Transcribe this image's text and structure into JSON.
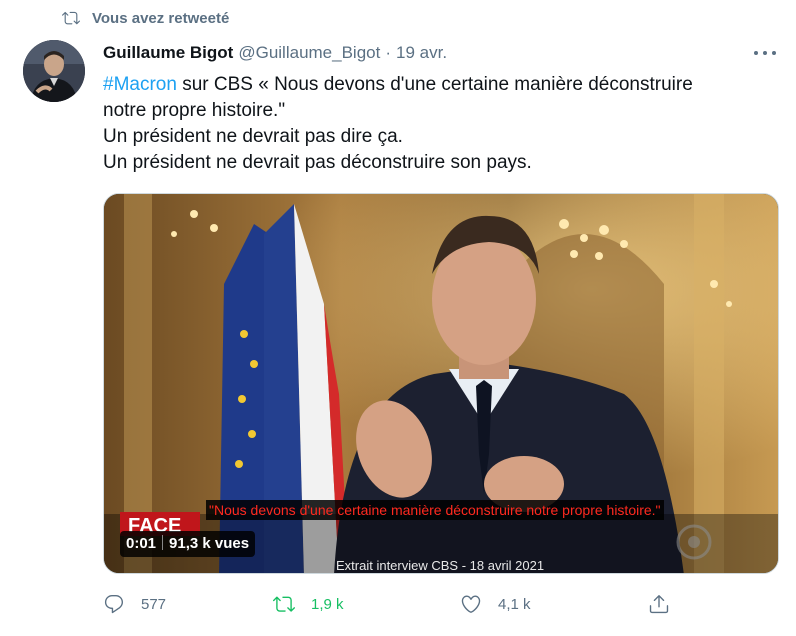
{
  "retweet_context": {
    "icon": "retweet-icon",
    "text": "Vous avez retweeté"
  },
  "tweet": {
    "author_name": "Guillaume Bigot",
    "author_handle": "@Guillaume_Bigot",
    "separator": "·",
    "timestamp": "19 avr.",
    "text": {
      "hashtag": "#Macron",
      "line1_rest": " sur CBS « Nous devons d'une certaine manière déconstruire",
      "line2": "notre propre histoire.\"",
      "line3": "Un président ne devrait pas dire ça.",
      "line4": "Un président ne devrait pas déconstruire son pays."
    },
    "media": {
      "subtitle": "\"Nous devons d'une certaine manière déconstruire notre propre histoire.\"",
      "video_time": "0:01",
      "video_views": "91,3 k vues",
      "caption": "Extrait interview CBS - 18 avril 2021",
      "logo_text": "FACE"
    },
    "actions": {
      "reply_count": "577",
      "retweet_count": "1,9 k",
      "like_count": "4,1 k"
    }
  },
  "colors": {
    "accent": "#1da1f2",
    "retweeted": "#17bf63",
    "secondary_text": "#5b7083",
    "subtitle_red": "#ff2a1f"
  }
}
